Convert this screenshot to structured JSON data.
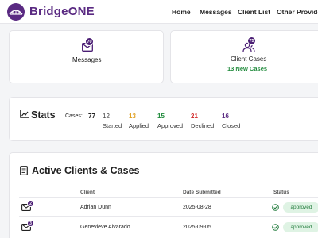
{
  "header": {
    "brand": "BridgeONE",
    "nav": [
      "Home",
      "Messages",
      "Client List",
      "Other Provide"
    ]
  },
  "cards": {
    "messages": {
      "badge": "70",
      "label": "Messages"
    },
    "client_cases": {
      "badge": "75",
      "label": "Client Cases",
      "sub": "13 New Cases"
    }
  },
  "stats": {
    "title": "Stats",
    "cases_label": "Cases:",
    "total": "77",
    "items": [
      {
        "value": "12",
        "label": "Started",
        "color": "#444444"
      },
      {
        "value": "13",
        "label": "Applied",
        "color": "#e0a020"
      },
      {
        "value": "15",
        "label": "Approved",
        "color": "#1f8a3b"
      },
      {
        "value": "21",
        "label": "Declined",
        "color": "#d32f2f"
      },
      {
        "value": "16",
        "label": "Closed",
        "color": "#5a2a82"
      }
    ]
  },
  "clients": {
    "title": "Active Clients & Cases",
    "columns": [
      "Client",
      "Date Submitted",
      "Status"
    ],
    "rows": [
      {
        "badge": "2",
        "client": "Adrian Dunn",
        "date": "2025-08-28",
        "status": "approved"
      },
      {
        "badge": "3",
        "client": "Genevieve Alvarado",
        "date": "2025-09-05",
        "status": "approved"
      }
    ]
  },
  "colors": {
    "brand": "#5a2a82",
    "accent": "#4b1e74",
    "success": "#1f8a3b"
  }
}
